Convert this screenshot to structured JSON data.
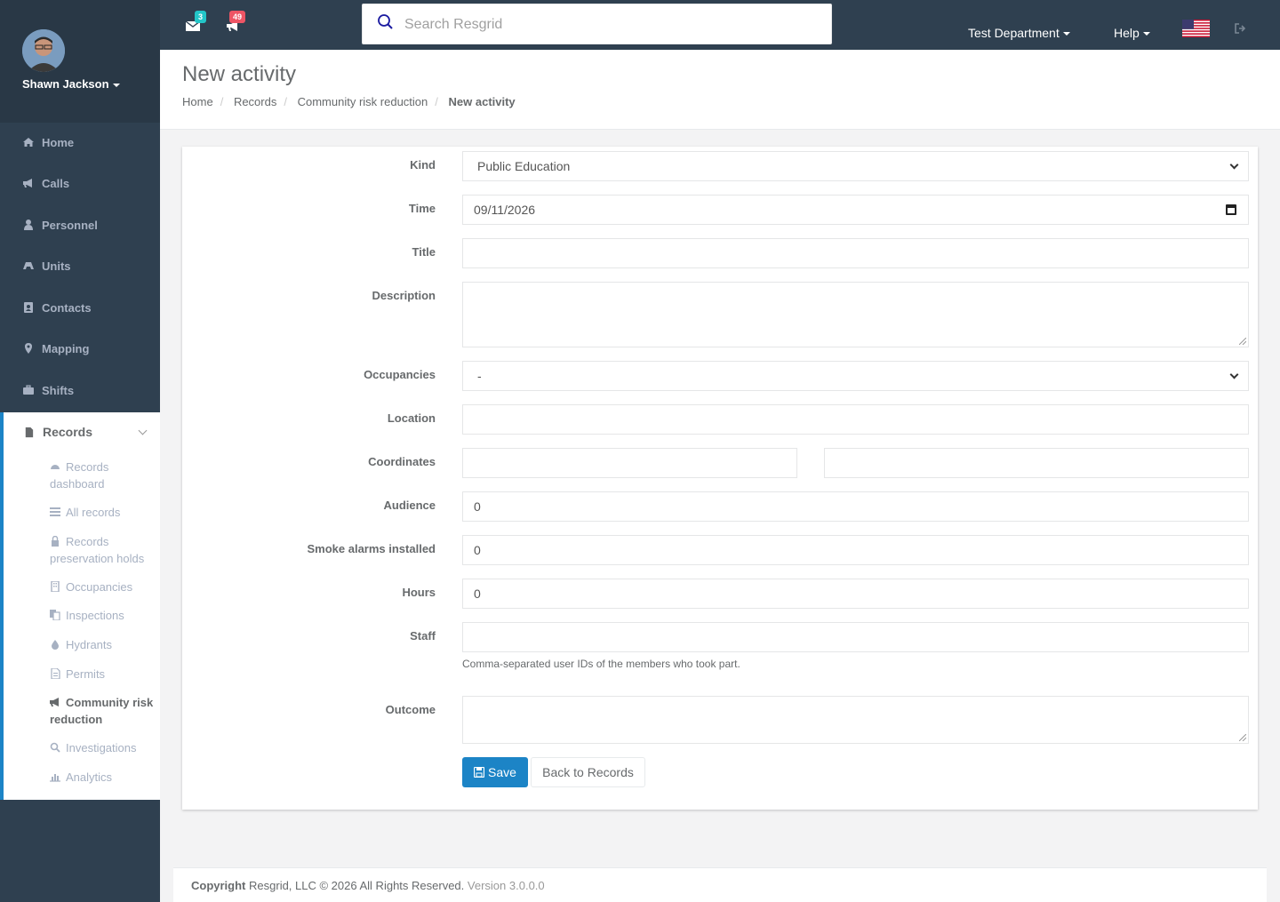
{
  "user": {
    "name": "Shawn Jackson"
  },
  "sidebar": {
    "items": [
      {
        "label": "Home",
        "icon": "home-icon"
      },
      {
        "label": "Calls",
        "icon": "bullhorn-icon"
      },
      {
        "label": "Personnel",
        "icon": "user-icon"
      },
      {
        "label": "Units",
        "icon": "truck-icon"
      },
      {
        "label": "Contacts",
        "icon": "address-book-icon"
      },
      {
        "label": "Mapping",
        "icon": "map-marker-icon"
      },
      {
        "label": "Shifts",
        "icon": "briefcase-icon"
      }
    ],
    "records": {
      "label": "Records",
      "subitems": [
        {
          "label": "Records dashboard",
          "icon": "dashboard-icon"
        },
        {
          "label": "All records",
          "icon": "list-icon"
        },
        {
          "label": "Records preservation holds",
          "icon": "lock-icon"
        },
        {
          "label": "Occupancies",
          "icon": "building-icon"
        },
        {
          "label": "Inspections",
          "icon": "copy-icon"
        },
        {
          "label": "Hydrants",
          "icon": "tint-icon"
        },
        {
          "label": "Permits",
          "icon": "file-icon"
        },
        {
          "label": "Community risk reduction",
          "icon": "bullhorn-icon"
        },
        {
          "label": "Investigations",
          "icon": "search-icon"
        },
        {
          "label": "Analytics",
          "icon": "bar-chart-icon"
        }
      ]
    }
  },
  "topbar": {
    "messages_count": "3",
    "calls_count": "49",
    "search_placeholder": "Search Resgrid",
    "department": "Test Department",
    "help": "Help",
    "colors": {
      "bar": "#2f4050",
      "messages_badge": "#23c6c8",
      "calls_badge": "#ed5565"
    }
  },
  "page": {
    "title": "New activity",
    "breadcrumb": [
      "Home",
      "Records",
      "Community risk reduction",
      "New activity"
    ]
  },
  "form": {
    "kind": {
      "label": "Kind",
      "value": "Public Education"
    },
    "time": {
      "label": "Time",
      "value": "09/11/2026"
    },
    "title": {
      "label": "Title",
      "value": ""
    },
    "description": {
      "label": "Description",
      "value": ""
    },
    "occupancies": {
      "label": "Occupancies",
      "value": "-"
    },
    "location": {
      "label": "Location",
      "value": ""
    },
    "coordinates": {
      "label": "Coordinates",
      "lat": "",
      "lng": ""
    },
    "audience": {
      "label": "Audience",
      "value": "0"
    },
    "smoke_alarms": {
      "label": "Smoke alarms installed",
      "value": "0"
    },
    "hours": {
      "label": "Hours",
      "value": "0"
    },
    "staff": {
      "label": "Staff",
      "value": "",
      "help": "Comma-separated user IDs of the members who took part."
    },
    "outcome": {
      "label": "Outcome",
      "value": ""
    },
    "save_label": "Save",
    "back_label": "Back to Records",
    "accent": "#1c84c6"
  },
  "footer": {
    "copyright": "Copyright",
    "text": "Resgrid, LLC © 2026 All Rights Reserved.",
    "version": "Version 3.0.0.0"
  }
}
